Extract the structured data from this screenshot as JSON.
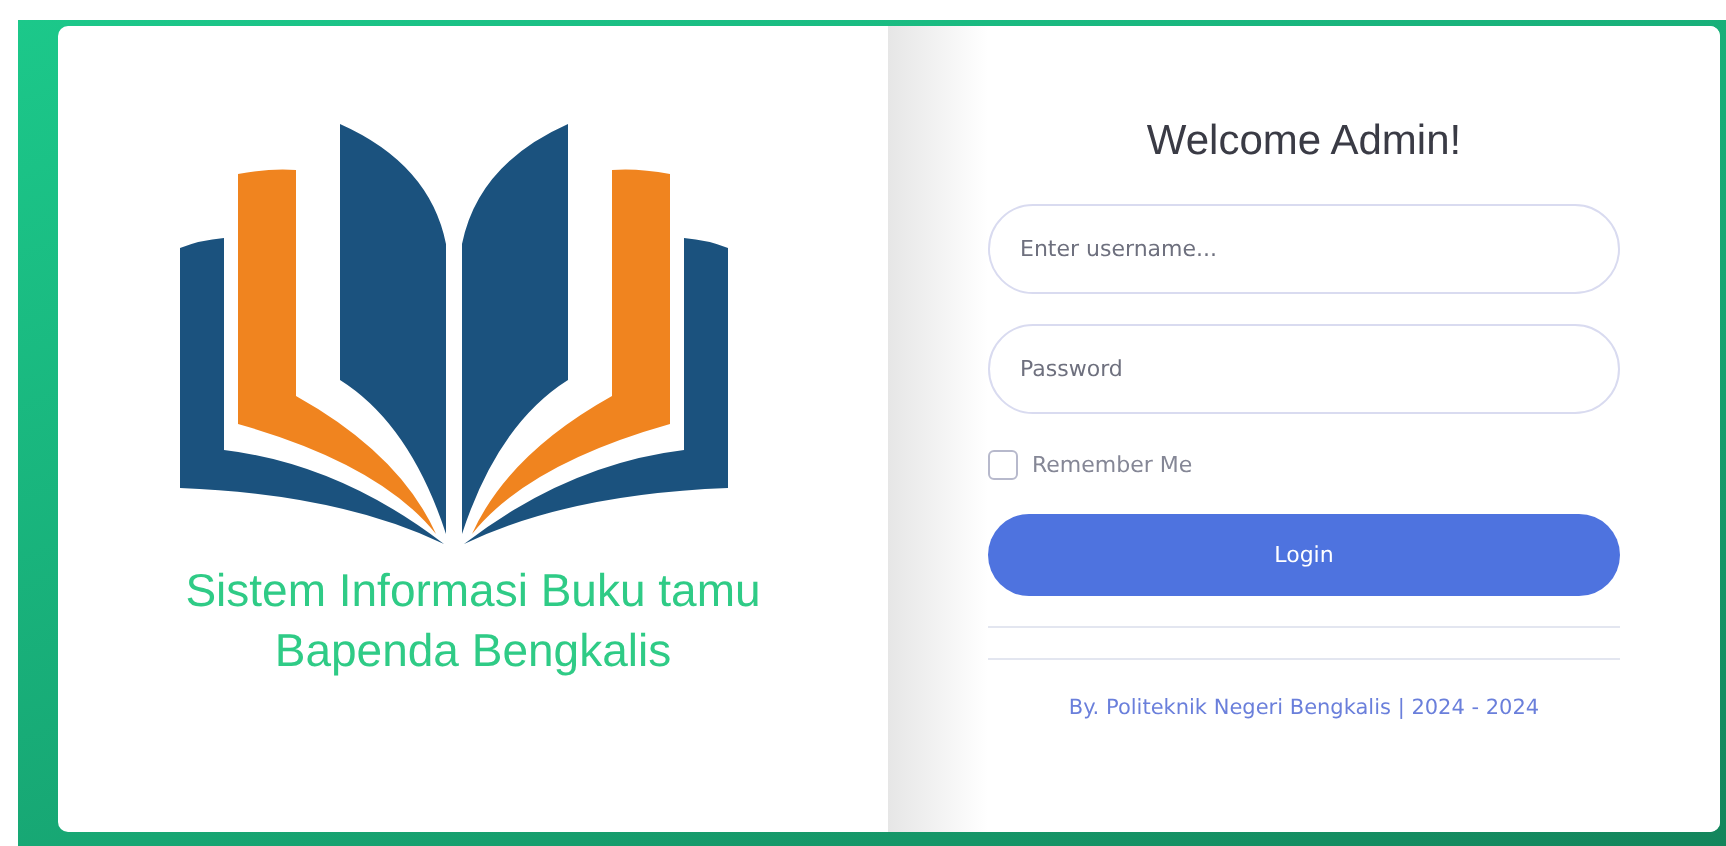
{
  "brand": {
    "lines": [
      "Sistem Informasi Buku tamu",
      "Bapenda Bengkalis"
    ]
  },
  "login": {
    "title": "Welcome Admin!",
    "username": {
      "placeholder": "Enter username..."
    },
    "password": {
      "placeholder": "Password"
    },
    "remember": {
      "label": "Remember Me",
      "checked": false
    },
    "button": "Login",
    "footer": "By. Politeknik Negeri Bengkalis | 2024 - 2024"
  }
}
